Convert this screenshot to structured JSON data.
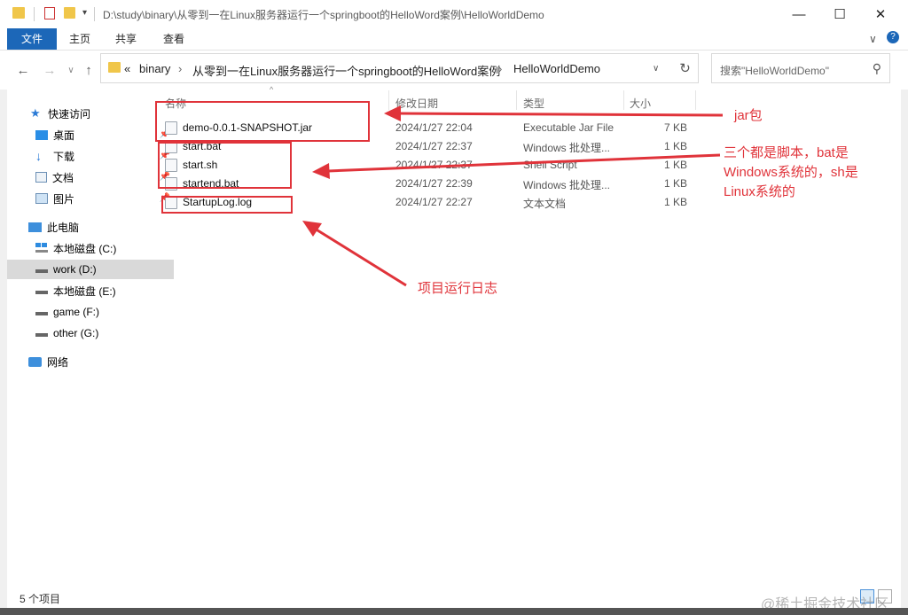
{
  "window": {
    "title": "D:\\study\\binary\\从零到一在Linux服务器运行一个springboot的HelloWord案例\\HelloWorldDemo",
    "minimize_label": "—",
    "maximize_label": "☐",
    "close_label": "✕"
  },
  "ribbon": {
    "tabs": [
      "文件",
      "主页",
      "共享",
      "查看"
    ],
    "collapse_label": "∨",
    "help_label": "?"
  },
  "address": {
    "back": "←",
    "forward": "→",
    "recent": "∨",
    "up": "↑",
    "overflow": "«",
    "crumbs": [
      "binary",
      "从零到一在Linux服务器运行一个springboot的HelloWord案例",
      "HelloWorldDemo"
    ],
    "separator": "›",
    "dropdown": "∨",
    "refresh": "↻"
  },
  "search": {
    "placeholder": "搜索\"HelloWorldDemo\"",
    "icon": "⚲"
  },
  "sidebar": {
    "items": [
      {
        "label": "快速访问",
        "icon": "star-icon",
        "pinned": false
      },
      {
        "label": "桌面",
        "icon": "desktop-icon",
        "pinned": true
      },
      {
        "label": "下载",
        "icon": "download-icon",
        "pinned": true
      },
      {
        "label": "文档",
        "icon": "documents-icon",
        "pinned": true
      },
      {
        "label": "图片",
        "icon": "pictures-icon",
        "pinned": true
      },
      {
        "label": "此电脑",
        "icon": "computer-icon",
        "pinned": false
      },
      {
        "label": "本地磁盘 (C:)",
        "icon": "windows-drive-icon",
        "pinned": false
      },
      {
        "label": "work (D:)",
        "icon": "drive-icon",
        "pinned": false,
        "selected": true
      },
      {
        "label": "本地磁盘 (E:)",
        "icon": "drive-icon",
        "pinned": false
      },
      {
        "label": "game (F:)",
        "icon": "drive-icon",
        "pinned": false
      },
      {
        "label": "other (G:)",
        "icon": "drive-icon",
        "pinned": false
      },
      {
        "label": "网络",
        "icon": "network-icon",
        "pinned": false
      }
    ],
    "pin_glyph": "⚲"
  },
  "file_list": {
    "columns": {
      "name": "名称",
      "modified": "修改日期",
      "type": "类型",
      "size": "大小"
    },
    "sort_glyph": "^",
    "rows": [
      {
        "name": "demo-0.0.1-SNAPSHOT.jar",
        "modified": "2024/1/27 22:04",
        "type": "Executable Jar File",
        "size": "7 KB"
      },
      {
        "name": "start.bat",
        "modified": "2024/1/27 22:37",
        "type": "Windows 批处理...",
        "size": "1 KB"
      },
      {
        "name": "start.sh",
        "modified": "2024/1/27 22:37",
        "type": "Shell Script",
        "size": "1 KB"
      },
      {
        "name": "startend.bat",
        "modified": "2024/1/27 22:39",
        "type": "Windows 批处理...",
        "size": "1 KB"
      },
      {
        "name": "StartupLog.log",
        "modified": "2024/1/27 22:27",
        "type": "文本文档",
        "size": "1 KB"
      }
    ]
  },
  "annotations": {
    "jar": "jar包",
    "scripts_line1": "三个都是脚本，bat是",
    "scripts_line2": "Windows系统的，sh是",
    "scripts_line3": "Linux系统的",
    "log": "项目运行日志",
    "color": "#e0333a"
  },
  "status": {
    "item_count": "5 个项目"
  },
  "watermark": "@稀土掘金技术社区"
}
